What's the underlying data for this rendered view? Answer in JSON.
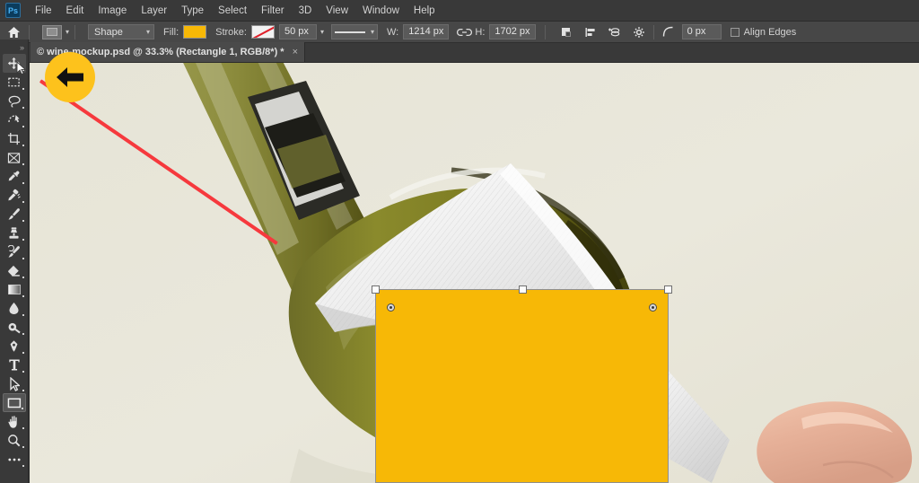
{
  "app": {
    "name": "Photoshop",
    "logo_text": "Ps"
  },
  "menubar": {
    "items": [
      {
        "label": "File"
      },
      {
        "label": "Edit"
      },
      {
        "label": "Image"
      },
      {
        "label": "Layer"
      },
      {
        "label": "Type"
      },
      {
        "label": "Select"
      },
      {
        "label": "Filter"
      },
      {
        "label": "3D"
      },
      {
        "label": "View"
      },
      {
        "label": "Window"
      },
      {
        "label": "Help"
      }
    ]
  },
  "options_bar": {
    "home_icon": "home-icon",
    "tool_preset_icon": "rectangle-tool-preset-icon",
    "mode_select": {
      "value": "Shape",
      "caret": "⌄"
    },
    "fill_label": "Fill:",
    "fill_color": "#f7b806",
    "stroke_label": "Stroke:",
    "stroke_value": "none",
    "stroke_width": "50 px",
    "line_style_icon": "line-style-icon",
    "width_label": "W:",
    "width_value": "1214 px",
    "link_icon": "link-dimensions-icon",
    "height_label": "H:",
    "height_value": "1702 px",
    "path_operations_icon": "path-operations-icon",
    "path_alignment_icon": "path-alignment-icon",
    "path_arrangement_icon": "path-arrangement-icon",
    "settings_icon": "gear-icon",
    "corner_radius_icon": "corner-radius-icon",
    "corner_radius_value": "0 px",
    "align_edges_label": "Align Edges",
    "align_edges_checked": false
  },
  "document_tab": {
    "title": "© wine-mockup.psd @ 33.3% (Rectangle 1, RGB/8*) *",
    "close_icon": "×"
  },
  "toolbar": {
    "collapse_icon": "»",
    "tools": [
      {
        "name": "move-tool",
        "state": "hovered"
      },
      {
        "name": "rectangular-marquee-tool",
        "state": "normal"
      },
      {
        "name": "lasso-tool",
        "state": "normal"
      },
      {
        "name": "object-selection-tool",
        "state": "normal"
      },
      {
        "name": "crop-tool",
        "state": "normal"
      },
      {
        "name": "frame-tool",
        "state": "normal"
      },
      {
        "name": "eyedropper-tool",
        "state": "normal"
      },
      {
        "name": "spot-healing-brush-tool",
        "state": "normal"
      },
      {
        "name": "brush-tool",
        "state": "normal"
      },
      {
        "name": "clone-stamp-tool",
        "state": "normal"
      },
      {
        "name": "history-brush-tool",
        "state": "normal"
      },
      {
        "name": "eraser-tool",
        "state": "normal"
      },
      {
        "name": "gradient-tool",
        "state": "normal"
      },
      {
        "name": "blur-tool",
        "state": "normal"
      },
      {
        "name": "dodge-tool",
        "state": "normal"
      },
      {
        "name": "pen-tool",
        "state": "normal"
      },
      {
        "name": "type-tool",
        "state": "normal"
      },
      {
        "name": "path-selection-tool",
        "state": "normal"
      },
      {
        "name": "rectangle-tool",
        "state": "active"
      },
      {
        "name": "hand-tool",
        "state": "normal"
      },
      {
        "name": "zoom-tool",
        "state": "normal"
      },
      {
        "name": "edit-toolbar-tool",
        "state": "normal"
      }
    ]
  },
  "canvas": {
    "zoom_level": "33.3%",
    "background_color": "#e8e6da",
    "shape": {
      "name": "Rectangle 1",
      "fill_color": "#f7b806",
      "width_px": "1214 px",
      "height_px": "1702 px"
    }
  },
  "annotation": {
    "badge_icon": "left-arrow-icon",
    "badge_color": "#fdc21c",
    "line_color": "#f6393d"
  }
}
